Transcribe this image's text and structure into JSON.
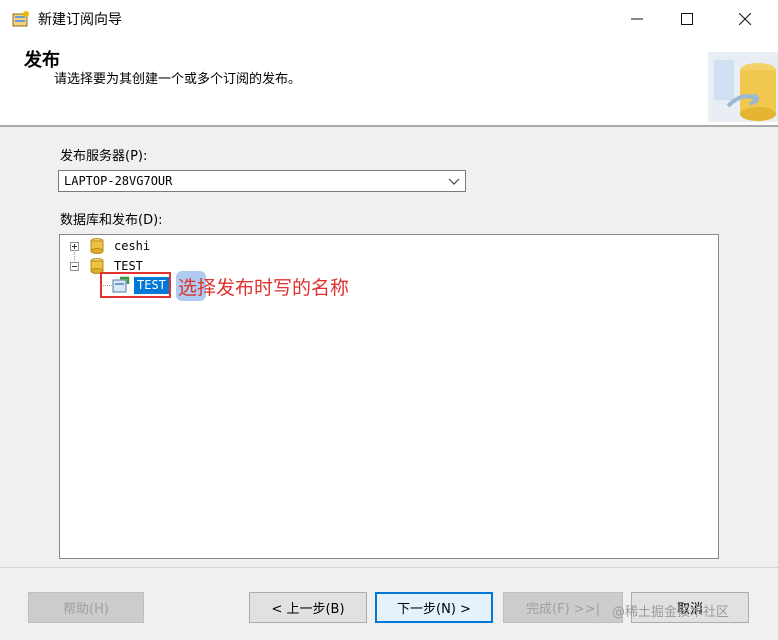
{
  "window": {
    "title": "新建订阅向导",
    "controls": {
      "minimize": "—",
      "maximize": "☐",
      "close": "✕"
    }
  },
  "header": {
    "title": "发布",
    "subtitle": "请选择要为其创建一个或多个订阅的发布。"
  },
  "server": {
    "label": "发布服务器(P):",
    "value": "LAPTOP-28VG7OUR"
  },
  "databases": {
    "label": "数据库和发布(D):",
    "tree": [
      {
        "name": "ceshi",
        "expanded": false
      },
      {
        "name": "TEST",
        "expanded": true,
        "children": [
          {
            "name": "TEST",
            "selected": true
          }
        ]
      }
    ]
  },
  "annotation": {
    "text": "选择发布时写的名称",
    "color": "#e0322e"
  },
  "buttons": {
    "help": "帮助(H)",
    "back": "< 上一步(B)",
    "next": "下一步(N) >",
    "finish": "完成(F) >>|",
    "cancel": "取消"
  },
  "watermark": "@稀土掘金技术社区",
  "colors": {
    "selection": "#0078d7",
    "accent": "#e0322e"
  }
}
